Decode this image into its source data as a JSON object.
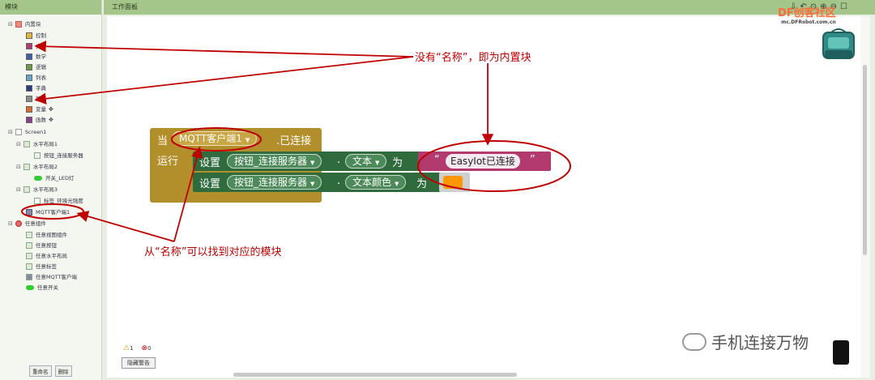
{
  "left_panel": {
    "title": "模块",
    "builtin": {
      "label": "内置块",
      "items": [
        {
          "label": "控制",
          "color": "#e2b437"
        },
        {
          "label": "文本",
          "color": "#b23a6e"
        },
        {
          "label": "数学",
          "color": "#3b5fa8"
        },
        {
          "label": "逻辑",
          "color": "#6f9a4c"
        },
        {
          "label": "列表",
          "color": "#6aa5c8"
        },
        {
          "label": "字典",
          "color": "#2a3b80"
        },
        {
          "label": "颜色",
          "color": "#8a8a8a"
        },
        {
          "label": "变量",
          "color": "#d96a2e"
        },
        {
          "label": "函数",
          "color": "#8b3e8b"
        }
      ]
    },
    "screen": {
      "label": "Screen1",
      "children": [
        {
          "label": "水平布局1",
          "child": "按钮_连接服务器"
        },
        {
          "label": "水平布局2",
          "child": "开关_LED灯"
        },
        {
          "label": "水平布局3",
          "child": "标签_环境光强度"
        },
        {
          "label": "MQTT客户端1",
          "child": ""
        }
      ]
    },
    "any": {
      "label": "任意组件",
      "items": [
        "任意视图组件",
        "任意按钮",
        "任意水平布局",
        "任意标签",
        "任意MQTT客户端",
        "任意开关"
      ]
    },
    "rename_button": "重命名",
    "delete_button": "删除"
  },
  "workspace": {
    "title": "工作面板",
    "event_block": {
      "when": "当",
      "component": "MQTT客户端1",
      "event": ".已连接",
      "do": "运行"
    },
    "set1": {
      "set": "设置",
      "component": "按钮_连接服务器",
      "dot": ".",
      "property": "文本",
      "to": "为",
      "quote_open": "“",
      "value": "EasyIot已连接",
      "quote_close": "”"
    },
    "set2": {
      "set": "设置",
      "component": "按钮_连接服务器",
      "dot": ".",
      "property": "文本颜色",
      "to": "为",
      "color_value": "#ff9800"
    },
    "warnings_count": "1",
    "errors_count": "0",
    "hide_warnings_button": "隐藏警告"
  },
  "annotations": {
    "top": "没有“名称”，即为内置块",
    "bottom": "从“名称”可以找到对应的模块"
  },
  "watermark": "手机连接万物",
  "logo": {
    "text": "DF创客社区",
    "sub": "mc.DFRobot.com.cn"
  }
}
